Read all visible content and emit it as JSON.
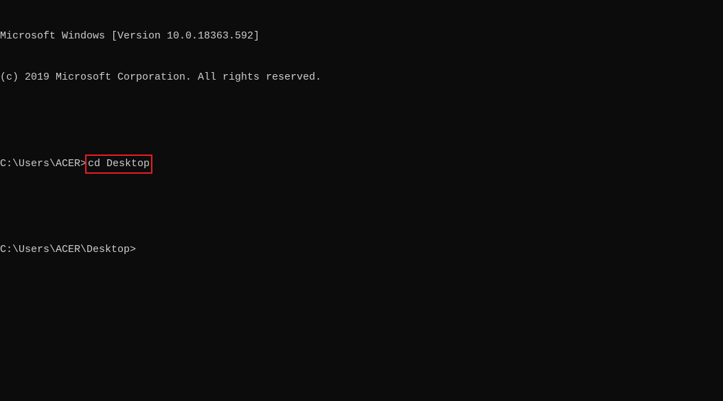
{
  "header": {
    "version_line": "Microsoft Windows [Version 10.0.18363.592]",
    "copyright_line": "(c) 2019 Microsoft Corporation. All rights reserved."
  },
  "prompts": {
    "line1_prompt": "C:\\Users\\ACER>",
    "line1_command": "cd Desktop",
    "line2_prompt": "C:\\Users\\ACER\\Desktop>"
  }
}
